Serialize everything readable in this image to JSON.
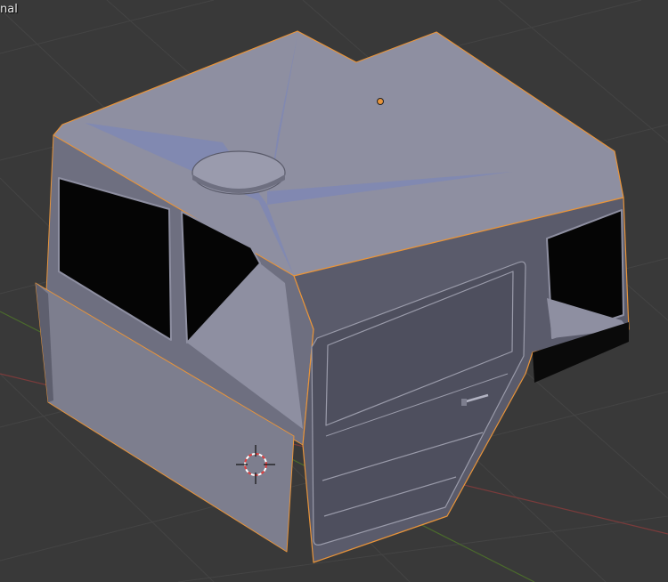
{
  "viewport": {
    "shading_label": "nal"
  },
  "colors": {
    "background": "#393939",
    "grid_line": "#444444",
    "x_axis": "#7a3b3b",
    "y_axis": "#4b6b2c",
    "selection_outline": "#e8943a",
    "mesh_light": "#8e8fa1",
    "mesh_mid": "#6e6f80",
    "mesh_dark": "#4e4f5e",
    "glass": "#050505"
  }
}
